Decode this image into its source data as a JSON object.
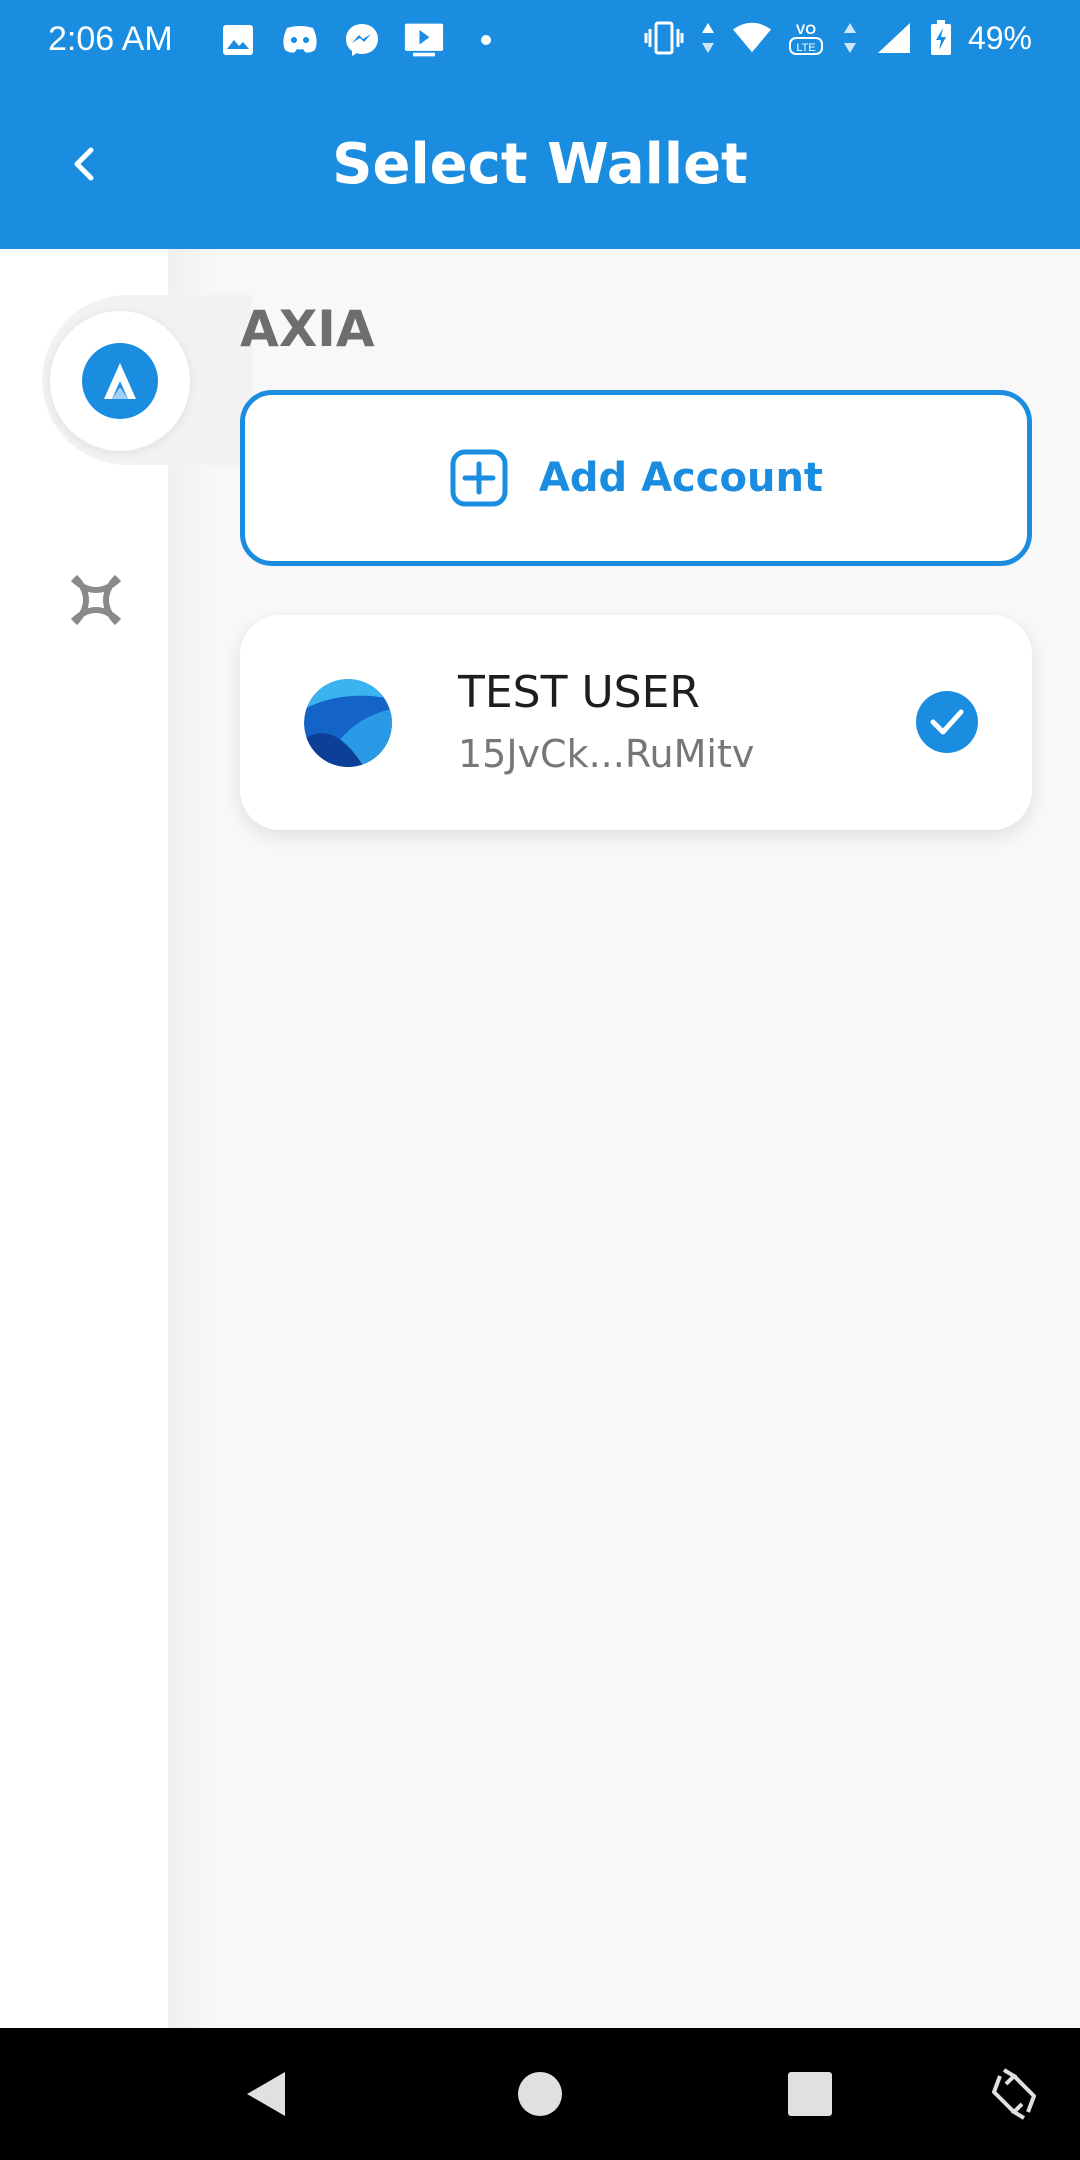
{
  "status_bar": {
    "time": "2:06 AM",
    "battery": "49%",
    "left_icons": [
      "gallery-icon",
      "discord-icon",
      "messenger-icon",
      "media-icon",
      "dot-icon"
    ],
    "right_icons": [
      "vibrate-icon",
      "data-arrows-icon",
      "wifi-icon",
      "volte-icon",
      "signal-icon",
      "battery-icon"
    ]
  },
  "app_bar": {
    "title": "Select Wallet",
    "back_icon": "chevron-left-icon"
  },
  "sidebar": {
    "chains": [
      {
        "name": "axia-chain",
        "icon": "axia-logo-icon",
        "selected": true
      },
      {
        "name": "other-chain",
        "icon": "polkadot-logo-icon",
        "selected": false
      }
    ]
  },
  "main": {
    "section_label": "AXIA",
    "add_account_label": "Add Account",
    "accounts": [
      {
        "name": "TEST USER",
        "address": "15JvCk...RuMitv",
        "selected": true
      }
    ]
  },
  "nav_bar": {
    "buttons": [
      "back-triangle-icon",
      "home-circle-icon",
      "recents-square-icon",
      "rotate-icon"
    ]
  },
  "colors": {
    "primary": "#1a8de0",
    "background": "#f8f8f8",
    "card": "#ffffff",
    "label_gray": "#6e6e6e"
  }
}
